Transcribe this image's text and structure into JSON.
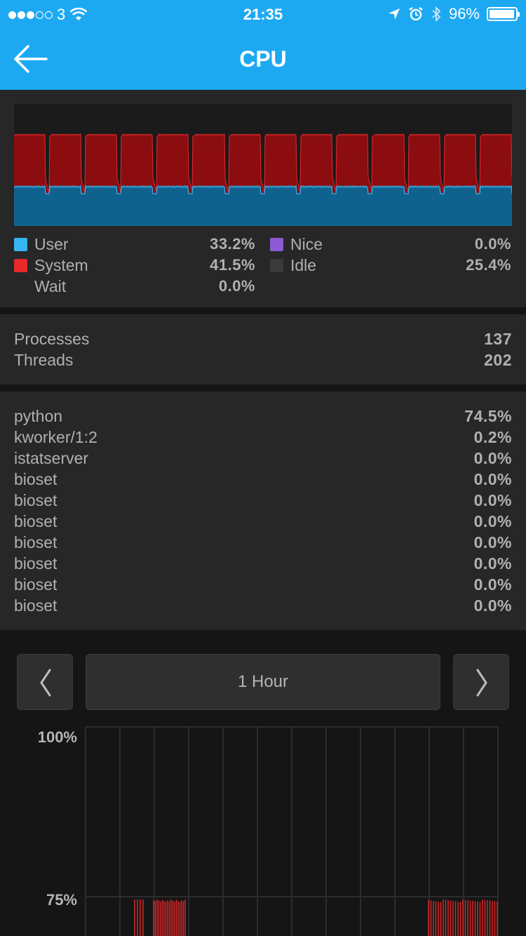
{
  "status_bar": {
    "carrier": "3",
    "time": "21:35",
    "battery_text": "96%",
    "battery_level": 0.96
  },
  "nav": {
    "title": "CPU"
  },
  "usage": {
    "legend": [
      {
        "label": "User",
        "value": "33.2%",
        "color": "#35b6f0"
      },
      {
        "label": "System",
        "value": "41.5%",
        "color": "#e8282a"
      },
      {
        "label": "Wait",
        "value": "0.0%",
        "color": ""
      },
      {
        "label": "Nice",
        "value": "0.0%",
        "color": "#8c5ad4"
      },
      {
        "label": "Idle",
        "value": "25.4%",
        "color": "#3a3a3a"
      }
    ],
    "graph_colors": {
      "user": "#10628e",
      "system": "#8b0d10",
      "user_line": "#35b6f0",
      "system_line": "#e8282a"
    }
  },
  "counts": [
    {
      "label": "Processes",
      "value": "137"
    },
    {
      "label": "Threads",
      "value": "202"
    }
  ],
  "processes": [
    {
      "name": "python",
      "value": "74.5%"
    },
    {
      "name": "kworker/1:2",
      "value": "0.2%"
    },
    {
      "name": "istatserver",
      "value": "0.0%"
    },
    {
      "name": "bioset",
      "value": "0.0%"
    },
    {
      "name": "bioset",
      "value": "0.0%"
    },
    {
      "name": "bioset",
      "value": "0.0%"
    },
    {
      "name": "bioset",
      "value": "0.0%"
    },
    {
      "name": "bioset",
      "value": "0.0%"
    },
    {
      "name": "bioset",
      "value": "0.0%"
    },
    {
      "name": "bioset",
      "value": "0.0%"
    }
  ],
  "history": {
    "range_label": "1 Hour",
    "y_labels": [
      "100%",
      "75%"
    ],
    "bar_color": "#e8282a"
  }
}
